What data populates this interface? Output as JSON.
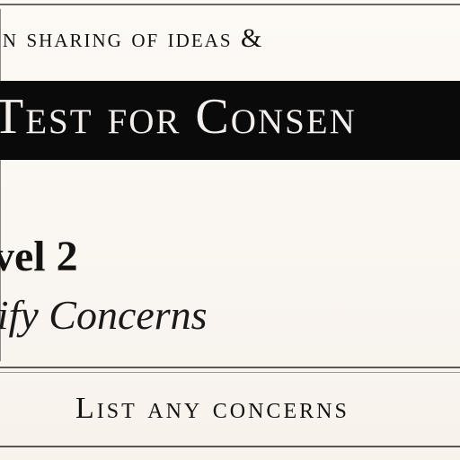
{
  "header": {
    "sharing_text": "en sharing of ideas &"
  },
  "band": {
    "title": "Test for Consen"
  },
  "level": {
    "heading": "vel 2",
    "subheading": "tify Concerns"
  },
  "footer": {
    "list_text": "List any concerns"
  }
}
